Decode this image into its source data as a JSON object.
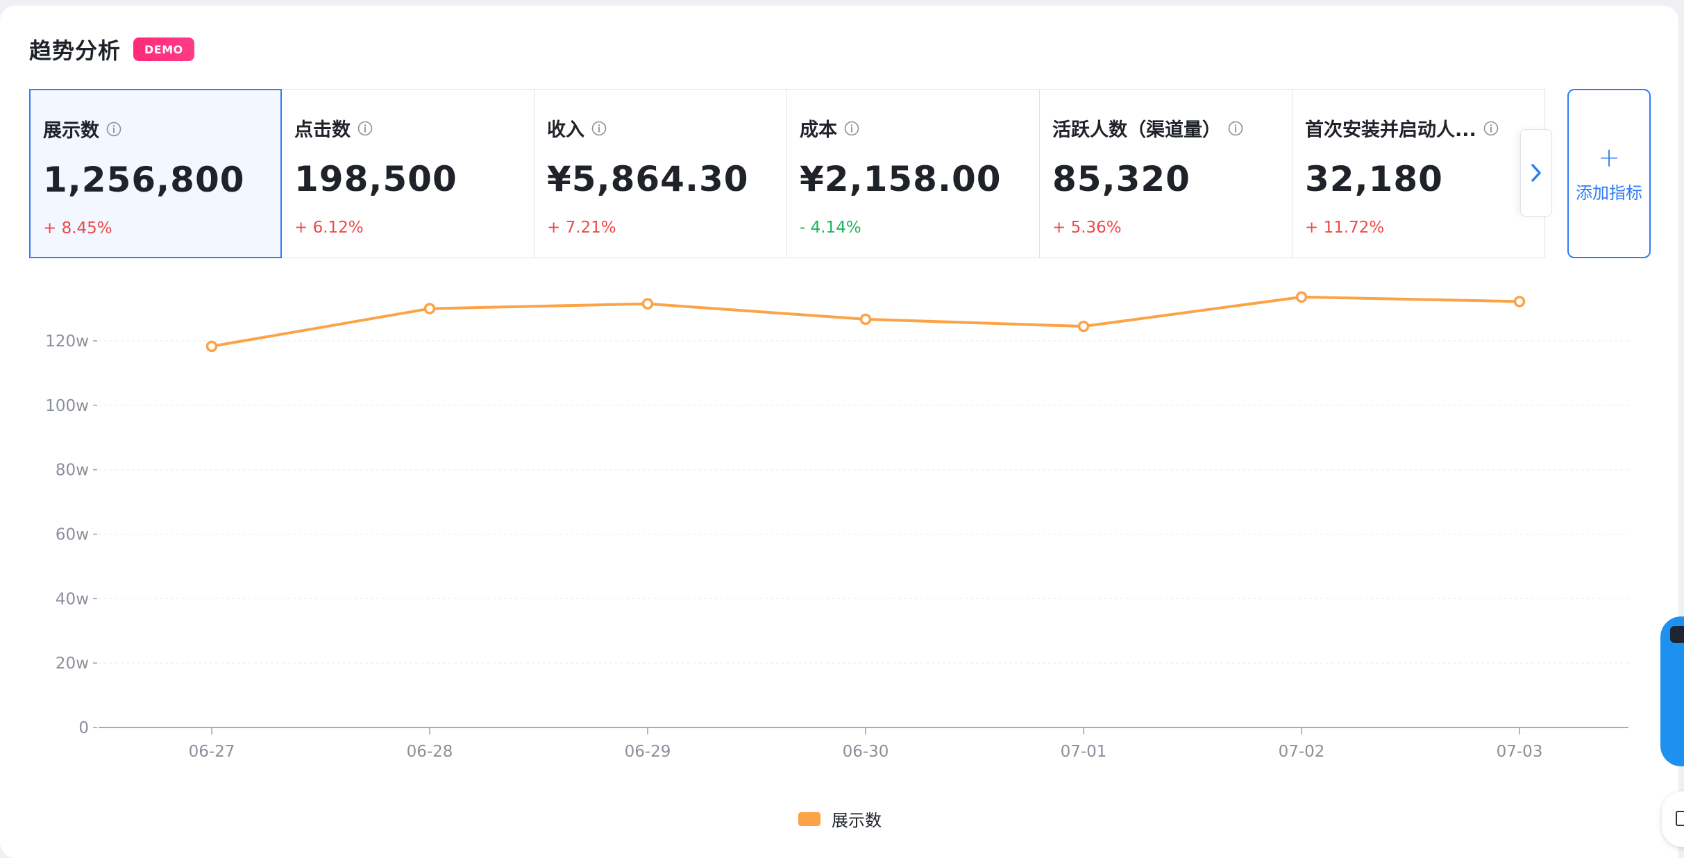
{
  "header": {
    "title": "趋势分析",
    "badge": "DEMO"
  },
  "metrics": [
    {
      "name": "展示数",
      "value": "1,256,800",
      "change": "+ 8.45%",
      "trend": "up",
      "active": true
    },
    {
      "name": "点击数",
      "value": "198,500",
      "change": "+ 6.12%",
      "trend": "up",
      "active": false
    },
    {
      "name": "收入",
      "value": "¥5,864.30",
      "change": "+ 7.21%",
      "trend": "up",
      "active": false
    },
    {
      "name": "成本",
      "value": "¥2,158.00",
      "change": "- 4.14%",
      "trend": "down",
      "active": false
    },
    {
      "name": "活跃人数（渠道量）",
      "value": "85,320",
      "change": "+ 5.36%",
      "trend": "up",
      "active": false
    },
    {
      "name": "首次安装并启动人...",
      "value": "32,180",
      "change": "+ 11.72%",
      "trend": "up",
      "active": false
    }
  ],
  "add_metric": {
    "icon": "+",
    "label": "添加指标"
  },
  "colors": {
    "accent": "#2f7cf6",
    "series": "#fba347",
    "up": "#f04848",
    "down": "#1fb35a"
  },
  "chart_data": {
    "type": "line",
    "categories": [
      "06-27",
      "06-28",
      "06-29",
      "06-30",
      "07-01",
      "07-02",
      "07-03"
    ],
    "series": [
      {
        "name": "展示数",
        "values": [
          1183000,
          1300000,
          1315000,
          1267000,
          1245000,
          1336000,
          1322000
        ]
      }
    ],
    "ylim": [
      0,
      1200000
    ],
    "yticks": [
      {
        "value": 0,
        "label": "0"
      },
      {
        "value": 200000,
        "label": "20w"
      },
      {
        "value": 400000,
        "label": "40w"
      },
      {
        "value": 600000,
        "label": "60w"
      },
      {
        "value": 800000,
        "label": "80w"
      },
      {
        "value": 1000000,
        "label": "100w"
      },
      {
        "value": 1200000,
        "label": "120w"
      }
    ],
    "legend": "bottom-center",
    "grid": true
  }
}
